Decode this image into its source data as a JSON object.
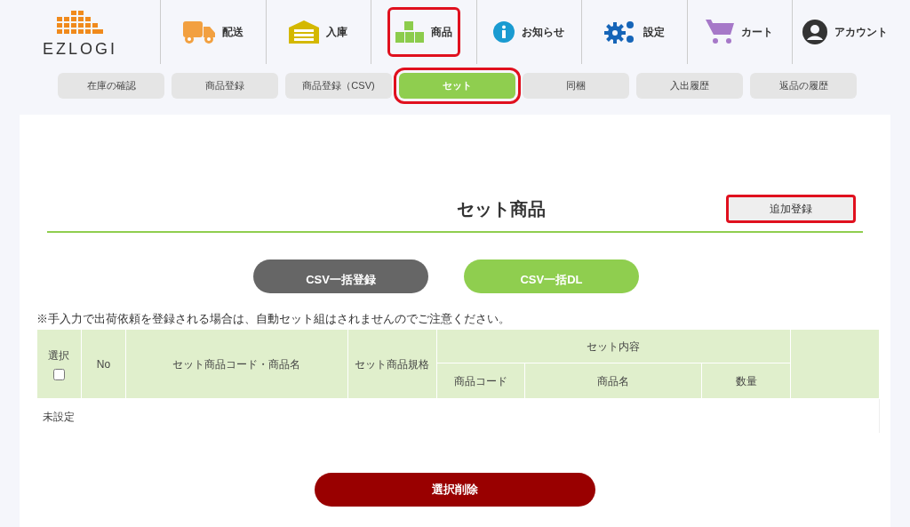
{
  "logo": {
    "text": "EZLOGI"
  },
  "nav": [
    {
      "label": "配送",
      "kind": "truck",
      "highlighted": false
    },
    {
      "label": "入庫",
      "kind": "warehouse",
      "highlighted": false
    },
    {
      "label": "商品",
      "kind": "boxes",
      "highlighted": true
    },
    {
      "label": "お知らせ",
      "kind": "info",
      "highlighted": false
    },
    {
      "label": "設定",
      "kind": "gears",
      "highlighted": false
    },
    {
      "label": "カート",
      "kind": "cart",
      "highlighted": false
    },
    {
      "label": "アカウント",
      "kind": "user",
      "highlighted": false
    }
  ],
  "subnav": [
    {
      "label": "在庫の確認",
      "selected": false,
      "highlighted": false
    },
    {
      "label": "商品登録",
      "selected": false,
      "highlighted": false
    },
    {
      "label": "商品登録（CSV)",
      "selected": false,
      "highlighted": false
    },
    {
      "label": "セット",
      "selected": true,
      "highlighted": true
    },
    {
      "label": "同梱",
      "selected": false,
      "highlighted": false
    },
    {
      "label": "入出履歴",
      "selected": false,
      "highlighted": false
    },
    {
      "label": "返品の履歴",
      "selected": false,
      "highlighted": false
    }
  ],
  "title": "セット商品",
  "add_button": {
    "label": "追加登録",
    "highlighted": true
  },
  "csv_buttons": [
    {
      "label": "CSV一括登録",
      "kind": "dark"
    },
    {
      "label": "CSV一括DL",
      "kind": "green"
    }
  ],
  "note": "※手入力で出荷依頼を登録される場合は、自動セット組はされませんのでご注意ください。",
  "table": {
    "select_column": {
      "label": "選択",
      "checked": false
    },
    "columns": [
      "No",
      "セット商品コード・商品名",
      "セット商品規格"
    ],
    "group": {
      "label": "セット内容",
      "columns": [
        "商品コード",
        "商品名",
        "数量"
      ]
    },
    "empty_text": "未設定"
  },
  "delete_button": "選択削除"
}
